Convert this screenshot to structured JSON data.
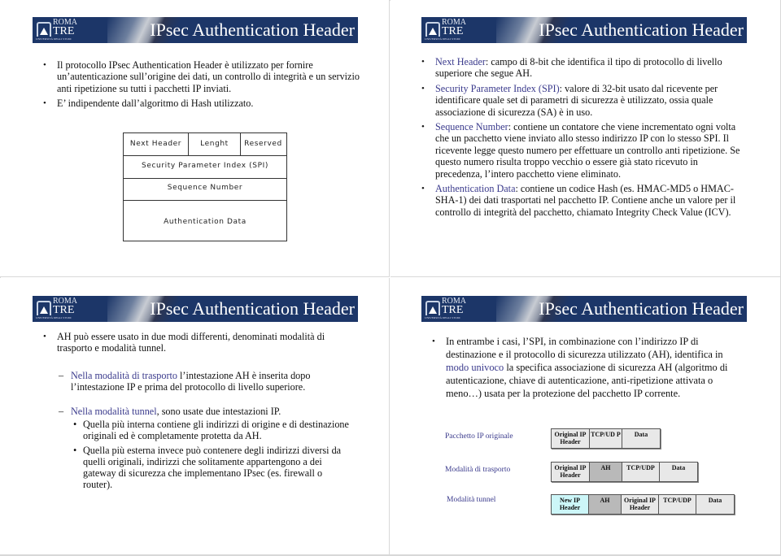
{
  "slides": [
    {
      "banner": {
        "logo_top": "ROMA",
        "logo_bottom": "TRE",
        "logo_caption": "UNIVERSITÀ DEGLI STUDI",
        "title": "IPsec Authentication Header"
      },
      "bullets": [
        "Il protocollo IPsec Authentication Header  è utilizzato per fornire un’autenticazione sull’origine dei dati, un controllo di integrità e un servizio anti ripetizione su tutti i pacchetti IP inviati.",
        "E’ indipendente dall’algoritmo di Hash utilizzato."
      ],
      "diagram": {
        "row1": [
          "Next Header",
          "Lenght",
          "Reserved"
        ],
        "row2": "Security Parameter Index (SPI)",
        "row3": "Sequence Number",
        "row4": "Authentication Data"
      }
    },
    {
      "banner": {
        "logo_top": "ROMA",
        "logo_bottom": "TRE",
        "logo_caption": "UNIVERSITÀ DEGLI STUDI",
        "title": "IPsec Authentication Header"
      },
      "bullets": [
        {
          "term": "Next Header",
          "text": ": campo di 8-bit che identifica il tipo di protocollo di livello superiore che segue AH."
        },
        {
          "term": "Security Parameter Index (SPI)",
          "text": ": valore di 32-bit usato dal ricevente per identificare quale set di parametri di sicurezza è utilizzato, ossia quale associazione di sicurezza (SA) è in uso."
        },
        {
          "term": "Sequence Number",
          "text": ": contiene un contatore che viene incrementato ogni volta che un pacchetto viene inviato allo stesso indirizzo IP con lo stesso SPI. Il ricevente legge questo numero per effettuare un controllo anti ripetizione. Se questo numero risulta troppo vecchio o essere già stato ricevuto in precedenza, l’intero pacchetto viene eliminato."
        },
        {
          "term": "Authentication Data",
          "text": ": contiene un codice Hash (es. HMAC-MD5 o HMAC-SHA-1) dei dati trasportati nel pacchetto IP. Contiene anche un valore per il controllo di integrità del pacchetto, chiamato Integrity Check Value (ICV)."
        }
      ]
    },
    {
      "banner": {
        "logo_top": "ROMA",
        "logo_bottom": "TRE",
        "logo_caption": "UNIVERSITÀ DEGLI STUDI",
        "title": "IPsec Authentication Header"
      },
      "bullet": "AH può essere usato in due modi differenti, denominati modalità di trasporto e modalità tunnel.",
      "transport": {
        "term": "Nella modalità di trasporto",
        "text": " l’intestazione AH è inserita dopo l’intestazione IP e prima del protocollo di livello superiore."
      },
      "tunnel": {
        "term": "Nella modalità tunnel",
        "text": ", sono usate due intestazioni IP."
      },
      "sub_bullets": [
        "Quella più interna contiene gli indirizzi di origine e di destinazione originali ed è completamente protetta da AH.",
        "Quella più esterna invece può contenere degli indirizzi diversi da quelli originali, indirizzi che solitamente appartengono a dei gateway di sicurezza che implementano IPsec (es. firewall o router)."
      ]
    },
    {
      "banner": {
        "logo_top": "ROMA",
        "logo_bottom": "TRE",
        "logo_caption": "UNIVERSITÀ DEGLI STUDI",
        "title": "IPsec Authentication Header"
      },
      "bullet": {
        "pre": "In entrambe i casi, l’SPI, in combinazione con  l’indirizzo IP di destinazione e il protocollo di sicurezza utilizzato (AH), identifica in ",
        "term": "modo univoco",
        "post": " la specifica associazione di sicurezza AH (algoritmo di autenticazione, chiave di autenticazione, anti-ripetizione attivata o meno…) usata per la protezione del pacchetto IP corrente."
      },
      "packets": [
        {
          "label": "Pacchetto IP originale",
          "cells": [
            "Original IP Header",
            "TCP/UD P",
            "Data"
          ]
        },
        {
          "label": "Modalità di trasporto",
          "cells": [
            "Original IP Header",
            "AH",
            "TCP/UDP",
            "Data"
          ]
        },
        {
          "label": "Modalità tunnel",
          "cells": [
            "New IP Header",
            "AH",
            "Original IP Header",
            "TCP/UDP",
            "Data"
          ]
        }
      ],
      "colors": {
        "ah_cell": "#b9b9b9",
        "new_ip_cell": "#ccf6f8",
        "default_cell": "#e8e8e8"
      }
    }
  ],
  "theme": {
    "banner_bg": "#1c3668",
    "accent_text": "#3a3a8c"
  }
}
